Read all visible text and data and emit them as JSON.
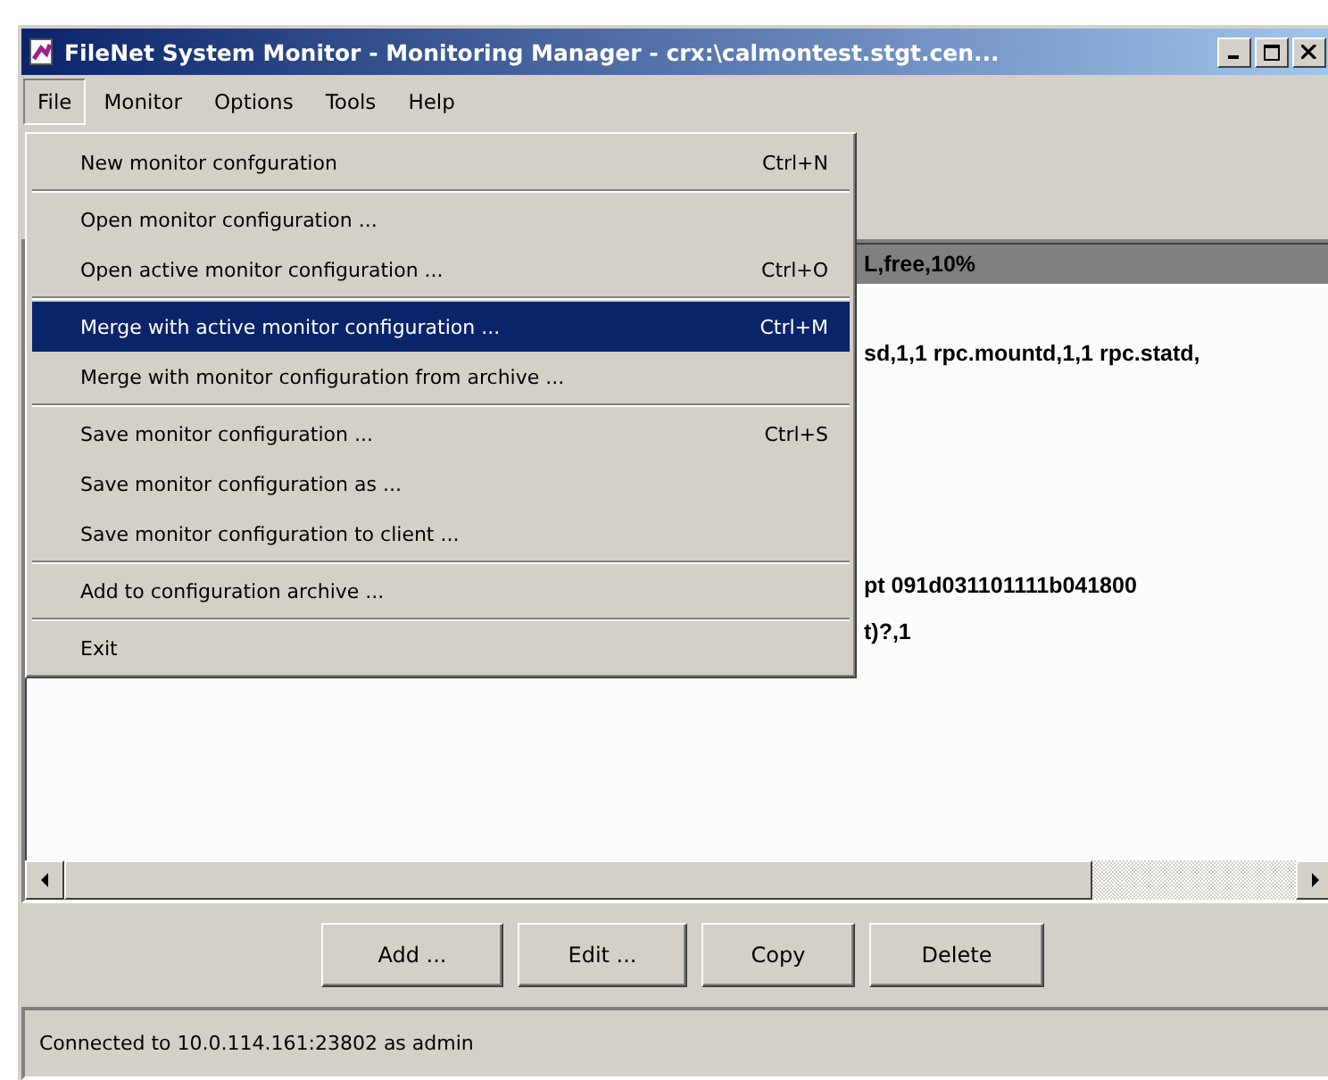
{
  "window": {
    "title": "FileNet System Monitor - Monitoring Manager - crx:\\calmontest.stgt.cen..."
  },
  "menubar": [
    {
      "label": "File",
      "selected": true
    },
    {
      "label": "Monitor",
      "selected": false
    },
    {
      "label": "Options",
      "selected": false
    },
    {
      "label": "Tools",
      "selected": false
    },
    {
      "label": "Help",
      "selected": false
    }
  ],
  "file_menu": {
    "groups": [
      [
        {
          "label": "New monitor confguration",
          "shortcut": "Ctrl+N",
          "selected": false
        }
      ],
      [
        {
          "label": "Open monitor configuration ...",
          "selected": false
        },
        {
          "label": "Open active monitor configuration  ...",
          "shortcut": "Ctrl+O",
          "selected": false
        }
      ],
      [
        {
          "label": "Merge with active monitor configuration ...",
          "shortcut": "Ctrl+M",
          "selected": true
        },
        {
          "label": "Merge with monitor configuration from archive ...",
          "selected": false
        }
      ],
      [
        {
          "label": "Save monitor configuration ...",
          "shortcut": "Ctrl+S",
          "selected": false
        },
        {
          "label": "Save monitor configuration as ...",
          "selected": false
        },
        {
          "label": "Save monitor configuration to client ...",
          "selected": false
        }
      ],
      [
        {
          "label": "Add to configuration archive ...",
          "selected": false
        }
      ],
      [
        {
          "label": "Exit",
          "selected": false
        }
      ]
    ]
  },
  "list": {
    "rows": [
      {
        "text": "L,free,10%",
        "selected": true
      },
      {
        "selected": false
      },
      {
        "text": "sd,1,1 rpc.mountd,1,1 rpc.statd,",
        "selected": false
      },
      {
        "selected": false
      },
      {
        "selected": false
      },
      {
        "selected": false
      },
      {
        "selected": false
      },
      {
        "text": "pt 091d031101111b041800",
        "selected": false
      },
      {
        "text": "t)?,1",
        "selected": false
      }
    ]
  },
  "buttons": [
    "Add ...",
    "Edit ...",
    "Copy",
    "Delete"
  ],
  "status_bar": "Connected to 10.0.114.161:23802 as admin"
}
